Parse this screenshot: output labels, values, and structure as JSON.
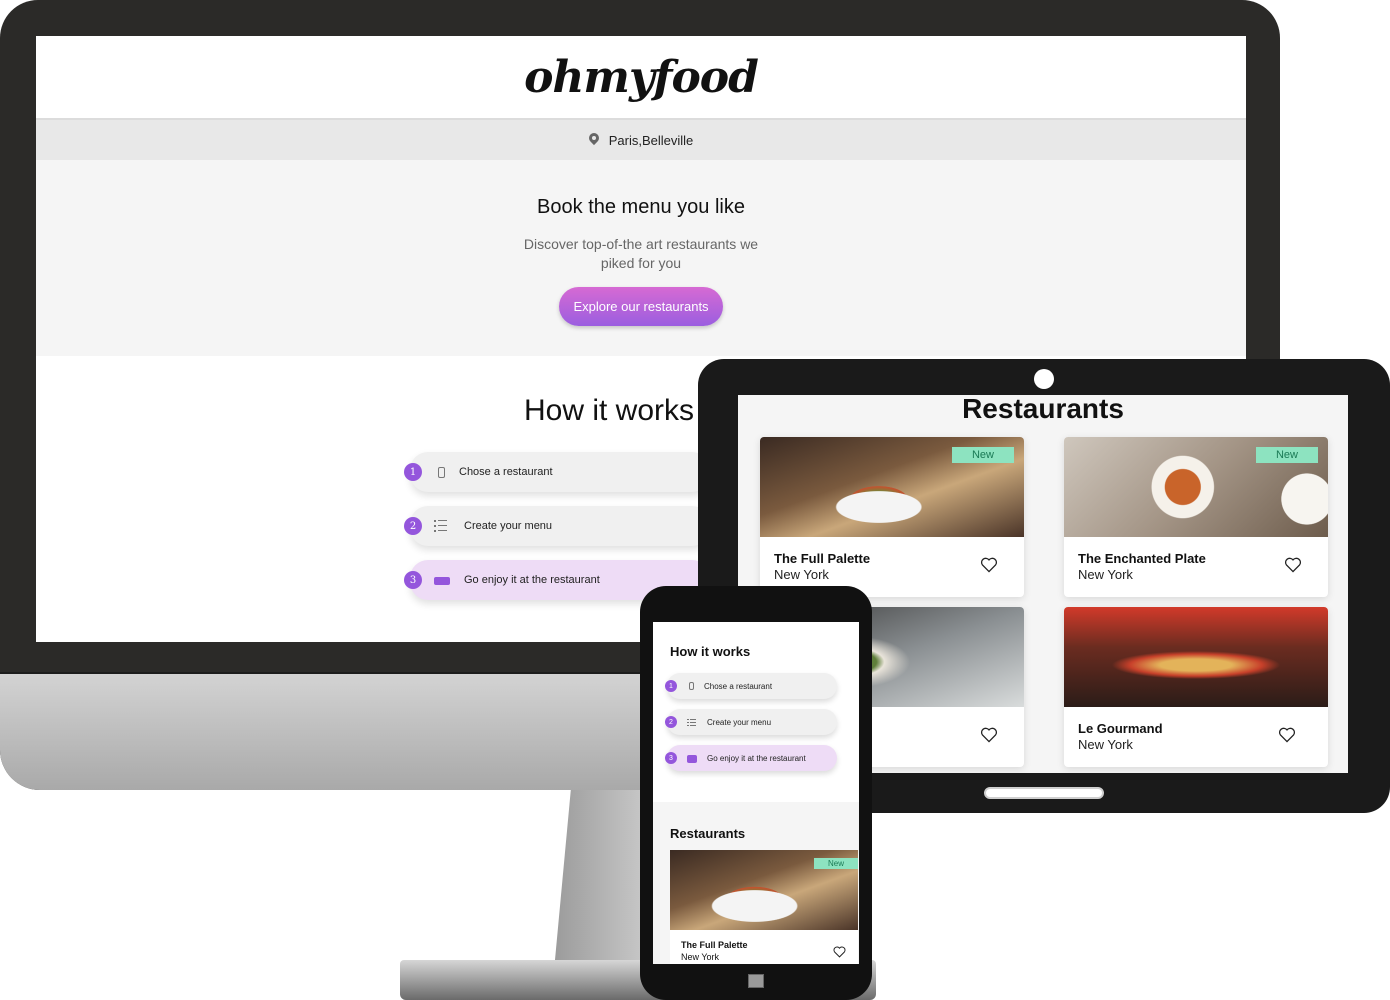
{
  "desktop": {
    "logo": "ohmyfood",
    "location": "Paris,Belleville",
    "hero": {
      "title": "Book the menu you like",
      "subtitle": "Discover top-of-the art restaurants we piked for you",
      "cta_label": "Explore our restaurants"
    },
    "how_it_works": {
      "title": "How it works",
      "steps": [
        {
          "num": "1",
          "label": "Chose a restaurant",
          "icon": "mobile-phone-icon"
        },
        {
          "num": "2",
          "label": "Create your menu",
          "icon": "list-icon"
        },
        {
          "num": "3",
          "label": "Go enjoy it at the restaurant",
          "icon": "store-icon"
        }
      ]
    }
  },
  "tablet": {
    "section_title": "Restaurants",
    "cards": [
      {
        "name": "The Full Palette",
        "city": "New York",
        "badge": "New"
      },
      {
        "name": "The Enchanted Plate",
        "city": "New York",
        "badge": "New"
      },
      {
        "name": "",
        "city": "",
        "badge": ""
      },
      {
        "name": "Le Gourmand",
        "city": "New York",
        "badge": ""
      }
    ]
  },
  "phone": {
    "how_title": "How it works",
    "steps": [
      {
        "num": "1",
        "label": "Chose a restaurant"
      },
      {
        "num": "2",
        "label": "Create your menu"
      },
      {
        "num": "3",
        "label": "Go enjoy it at the restaurant"
      }
    ],
    "restaurants_title": "Restaurants",
    "card": {
      "name": "The Full Palette",
      "city": "New York",
      "badge": "New"
    }
  },
  "colors": {
    "accent_purple": "#9456dc",
    "cta_gradient_top": "#d66ad3",
    "badge_green": "#8de3c0"
  }
}
